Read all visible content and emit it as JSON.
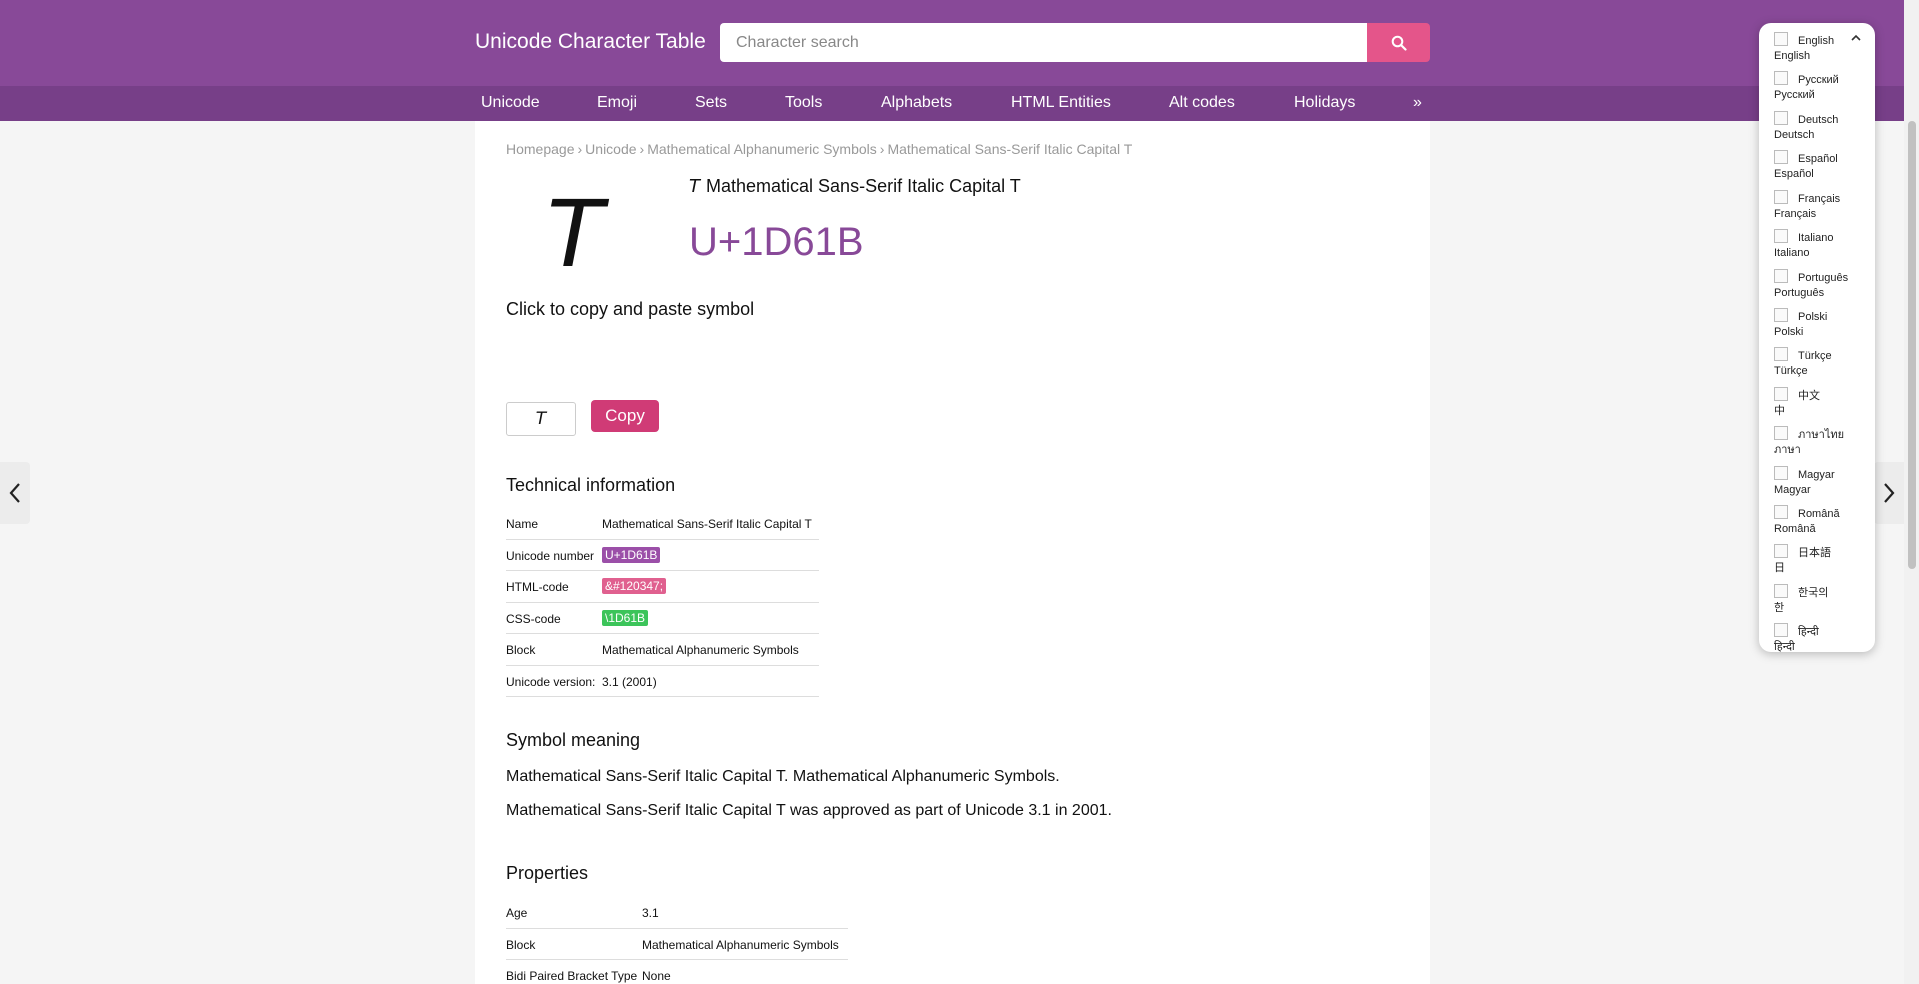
{
  "header": {
    "logo": "Unicode Character Table",
    "search_placeholder": "Character search"
  },
  "nav": [
    {
      "label": "Unicode"
    },
    {
      "label": "Emoji"
    },
    {
      "label": "Sets"
    },
    {
      "label": "Tools"
    },
    {
      "label": "Alphabets"
    },
    {
      "label": "HTML Entities"
    },
    {
      "label": "Alt codes"
    },
    {
      "label": "Holidays"
    },
    {
      "label": "»"
    }
  ],
  "breadcrumb": [
    "Homepage",
    "Unicode",
    "Mathematical Alphanumeric Symbols",
    "Mathematical Sans-Serif Italic Capital T"
  ],
  "character": {
    "symbol": "𝘛",
    "name": "Mathematical Sans-Serif Italic Capital T",
    "codepoint": "U+1D61B"
  },
  "copy": {
    "heading": "Click to copy and paste symbol",
    "value": "𝘛",
    "button": "Copy"
  },
  "technical": {
    "heading": "Technical information",
    "rows": [
      {
        "key": "Name",
        "value": "Mathematical Sans-Serif Italic Capital T"
      },
      {
        "key": "Unicode number",
        "value": "U+1D61B"
      },
      {
        "key": "HTML-code",
        "value": "&#120347;"
      },
      {
        "key": "CSS-code",
        "value": "\\1D61B"
      },
      {
        "key": "Block",
        "value": "Mathematical Alphanumeric Symbols"
      },
      {
        "key": "Unicode version:",
        "value": "3.1 (2001)"
      }
    ]
  },
  "meaning": {
    "heading": "Symbol meaning",
    "paragraphs": [
      "Mathematical Sans-Serif Italic Capital T. Mathematical Alphanumeric Symbols.",
      "Mathematical Sans-Serif Italic Capital T was approved as part of Unicode 3.1 in 2001."
    ]
  },
  "properties": {
    "heading": "Properties",
    "rows": [
      {
        "key": "Age",
        "value": "3.1"
      },
      {
        "key": "Block",
        "value": "Mathematical Alphanumeric Symbols"
      },
      {
        "key": "Bidi Paired Bracket Type",
        "value": "None"
      }
    ]
  },
  "languages": [
    {
      "label": "English",
      "alt": "English"
    },
    {
      "label": "Русский",
      "alt": "Русский"
    },
    {
      "label": "Deutsch",
      "alt": "Deutsch"
    },
    {
      "label": "Español",
      "alt": "Español"
    },
    {
      "label": "Français",
      "alt": "Français"
    },
    {
      "label": "Italiano",
      "alt": "Italiano"
    },
    {
      "label": "Português",
      "alt": "Português"
    },
    {
      "label": "Polski",
      "alt": "Polski"
    },
    {
      "label": "Türkçe",
      "alt": "Türkçe"
    },
    {
      "label": "中文",
      "alt": "中"
    },
    {
      "label": "ภาษาไทย",
      "alt": "ภาษา"
    },
    {
      "label": "Magyar",
      "alt": "Magyar"
    },
    {
      "label": "Română",
      "alt": "Română"
    },
    {
      "label": "日本語",
      "alt": "日"
    },
    {
      "label": "한국의",
      "alt": "한"
    },
    {
      "label": "हिन्दी",
      "alt": "हिन्दी"
    }
  ],
  "colors": {
    "header": "#884998",
    "nav": "#773f88",
    "accent_pink": "#e4558a",
    "codepoint_badge": "#9b4fa8",
    "html_badge": "#e0608f",
    "css_badge": "#3cc45a",
    "link": "#6a8fc4"
  },
  "icons": {
    "search": "search-icon",
    "prev": "chevron-left-icon",
    "next": "chevron-right-icon",
    "lang_toggle": "chevron-up-icon"
  }
}
